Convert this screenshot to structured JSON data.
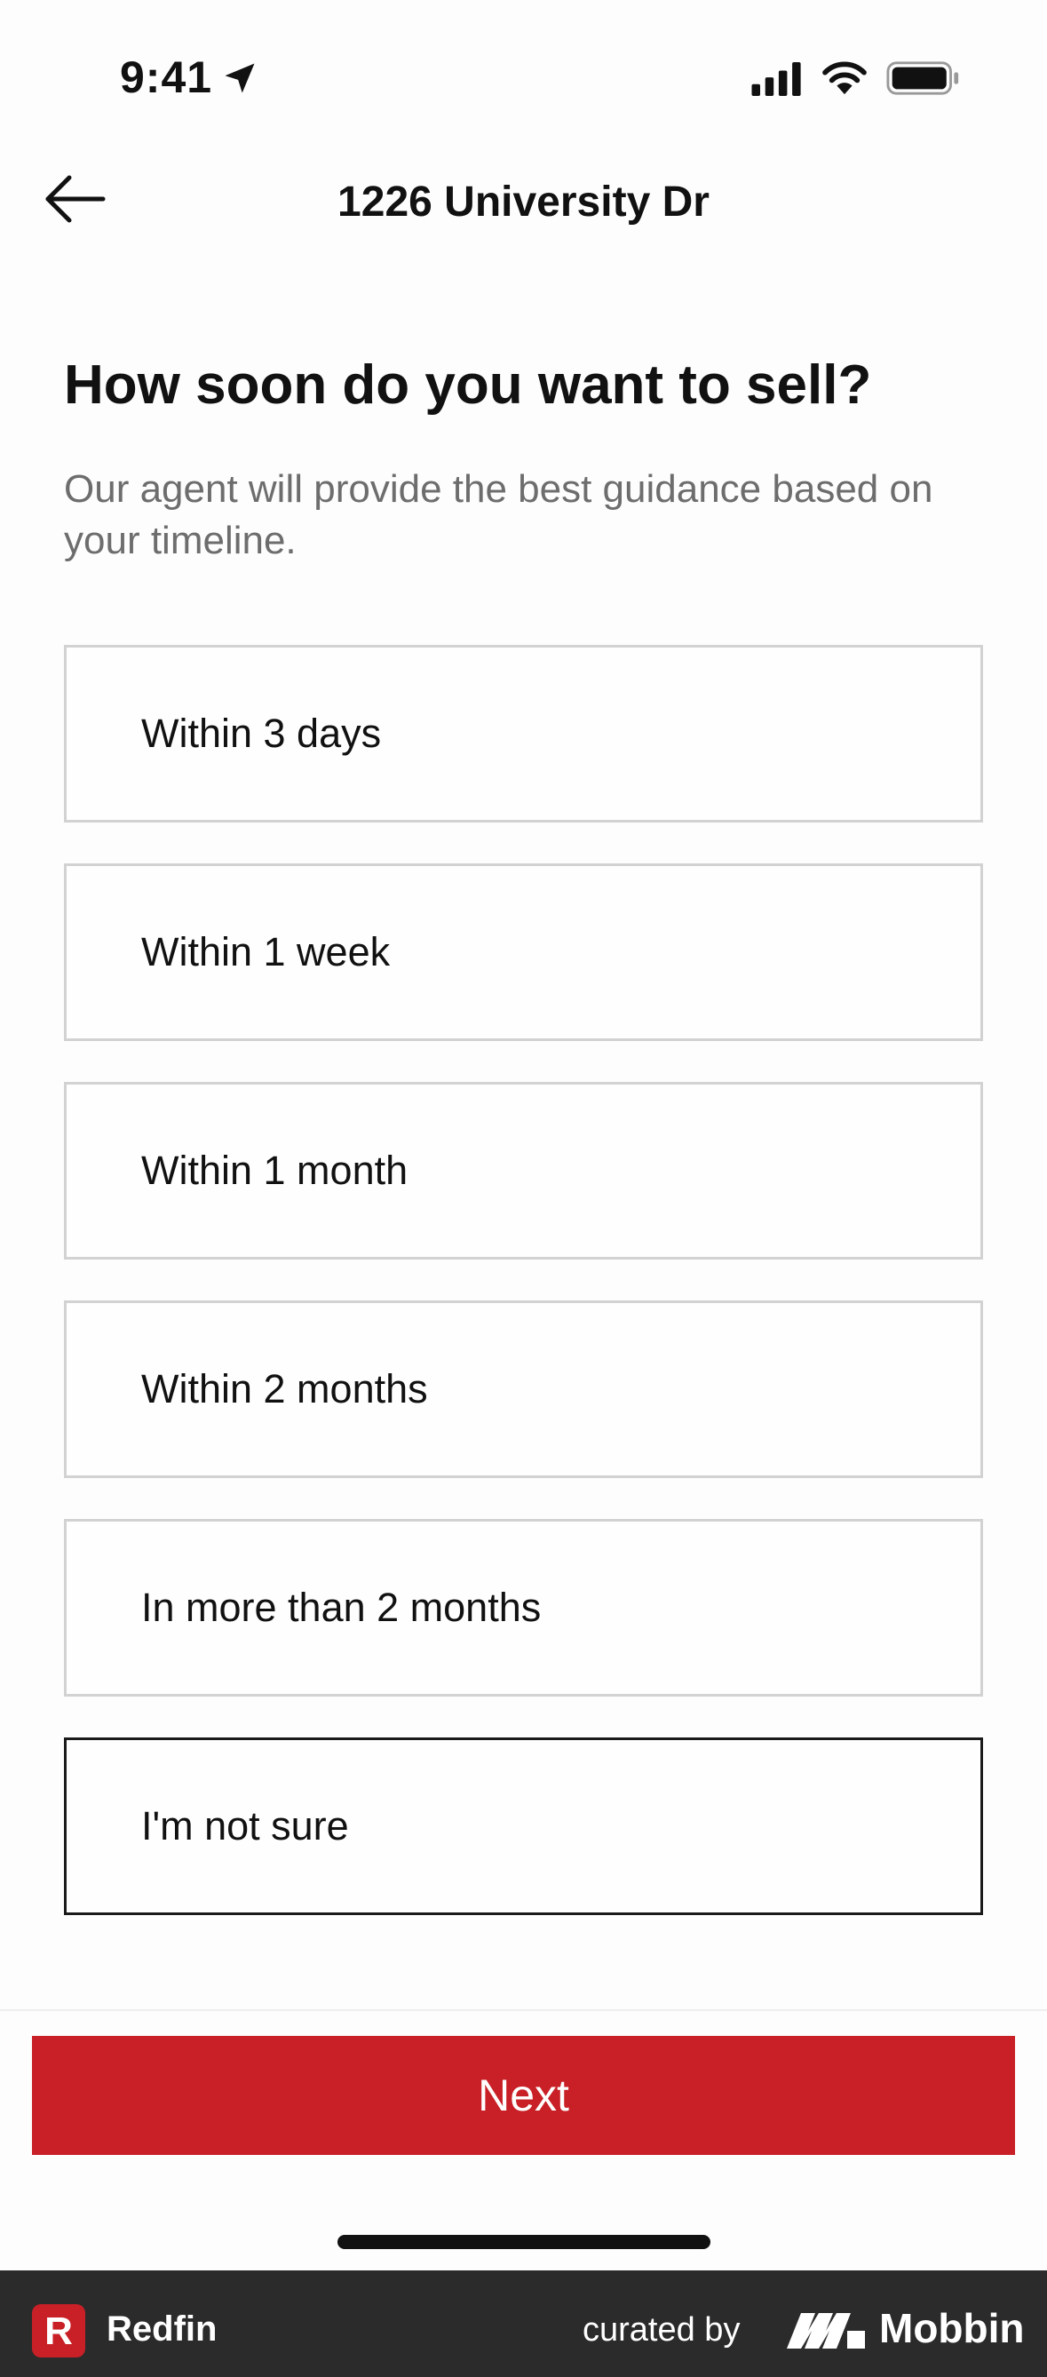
{
  "status_bar": {
    "time": "9:41",
    "icons": [
      "location-arrow-icon",
      "cellular-signal-icon",
      "wifi-icon",
      "battery-icon"
    ]
  },
  "nav": {
    "title": "1226 University Dr",
    "back_icon": "arrow-left-icon"
  },
  "question": {
    "title": "How soon do you want to sell?",
    "subtitle": "Our agent will provide the best guidance based on your timeline."
  },
  "options": [
    {
      "label": "Within 3 days",
      "selected": false
    },
    {
      "label": "Within 1 week",
      "selected": false
    },
    {
      "label": "Within 1 month",
      "selected": false
    },
    {
      "label": "Within 2 months",
      "selected": false
    },
    {
      "label": "In more than 2 months",
      "selected": false
    },
    {
      "label": "I'm not sure",
      "selected": true
    }
  ],
  "footer": {
    "next_label": "Next"
  },
  "attribution": {
    "app_name": "Redfin",
    "app_logo_letter": "R",
    "curated_by": "curated by",
    "brand": "Mobbin"
  },
  "colors": {
    "accent": "#c82026",
    "text": "#111111",
    "muted_text": "#6d6d6d",
    "option_border": "#d2d2d2",
    "selected_border": "#1a1a1a",
    "attribution_bar": "#2b2b2b"
  }
}
